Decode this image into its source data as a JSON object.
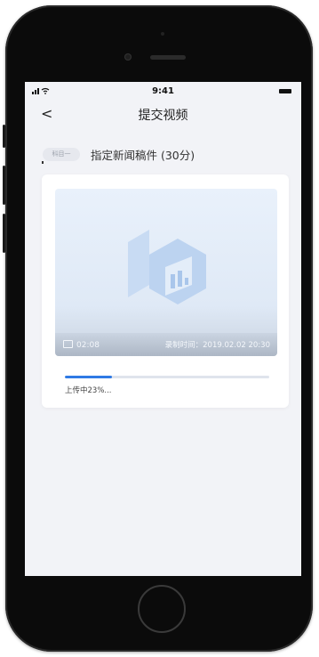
{
  "status_bar": {
    "time": "9:41"
  },
  "nav": {
    "back": "<",
    "title": "提交视频"
  },
  "subject": {
    "tag": "科目一",
    "text": "指定新闻稿件 (30分)"
  },
  "video": {
    "duration": "02:08",
    "recorded_at": "录制时间：2019.02.02 20:30"
  },
  "upload": {
    "progress_percent": 23,
    "status": "上传中23%..."
  },
  "colors": {
    "accent": "#2f7ae5",
    "screen_bg": "#f2f3f7",
    "phone_body": "#0b0b0b"
  }
}
